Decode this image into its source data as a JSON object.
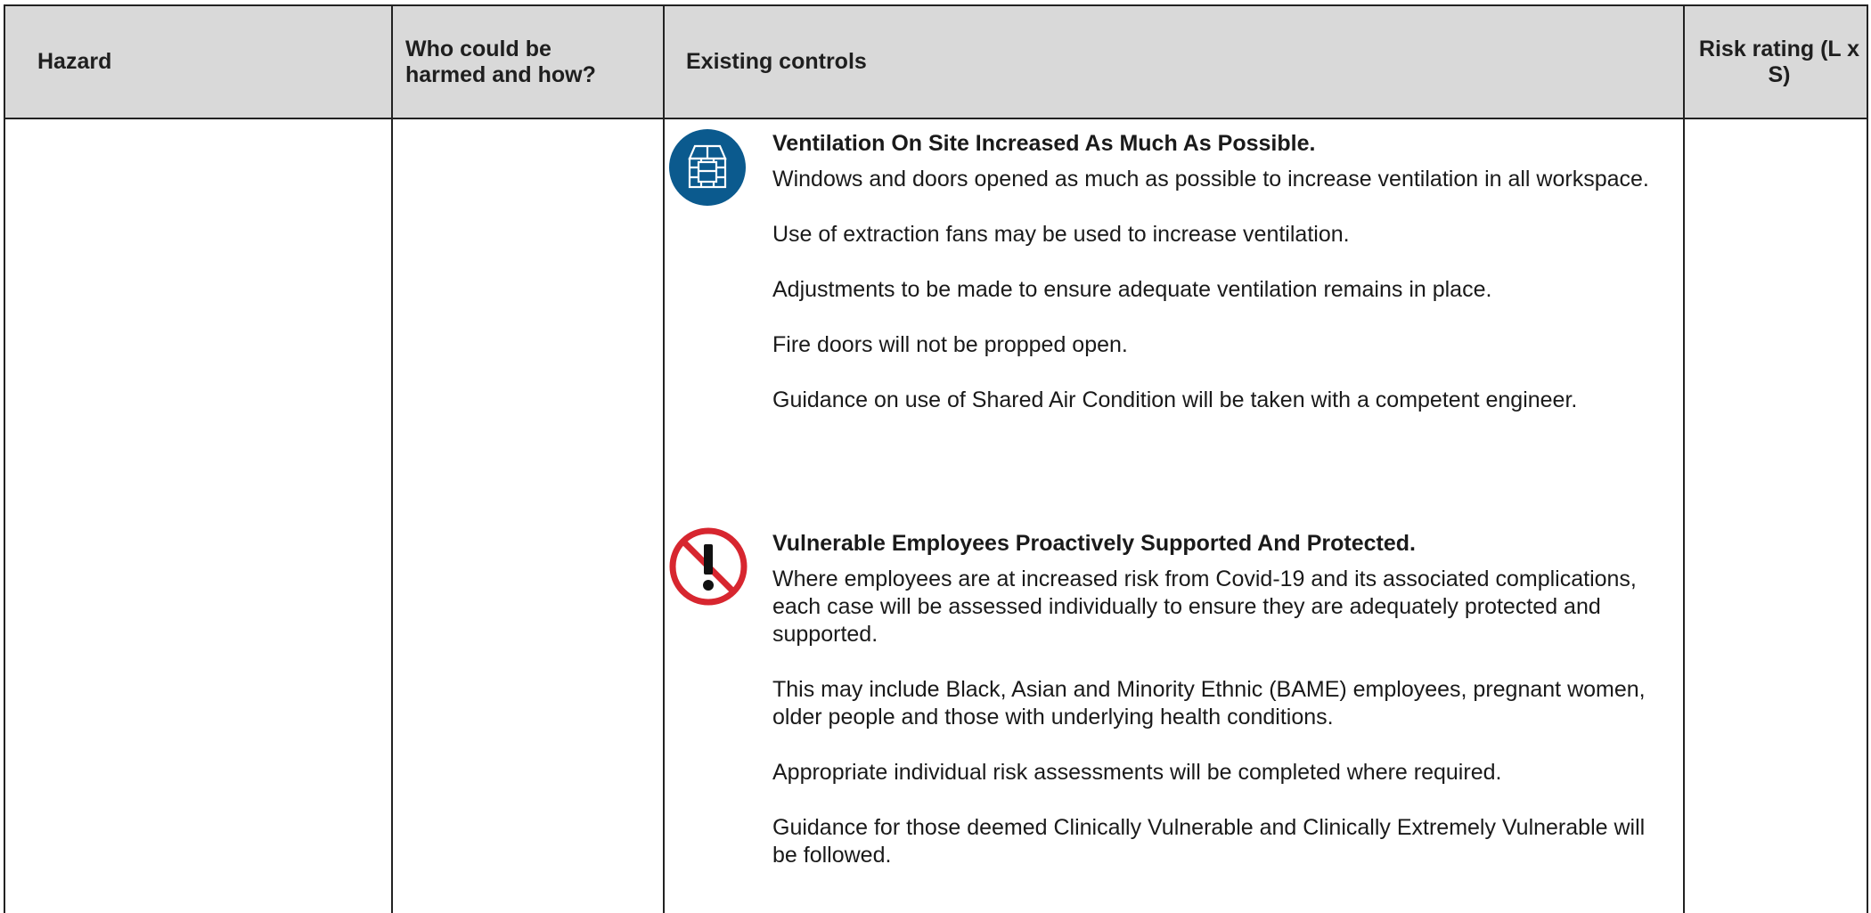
{
  "header": {
    "hazard": "Hazard",
    "who": "Who could be harmed and how?",
    "controls": "Existing controls",
    "risk": "Risk rating (L x S)"
  },
  "sections": [
    {
      "icon": "ventilation-icon",
      "icon_color": "#0b5a8e",
      "title": "Ventilation On Site Increased As Much As Possible.",
      "paragraphs": [
        "Windows and doors opened as much as possible to increase ventilation in all workspace.",
        "Use of extraction fans may be used to increase ventilation.",
        "Adjustments to be made to ensure adequate ventilation remains in place.",
        "Fire doors will not be propped open.",
        "Guidance on use of Shared Air Condition will be taken with a competent engineer."
      ]
    },
    {
      "icon": "prohibition-warning-icon",
      "icon_color": "#d7262f",
      "title": "Vulnerable Employees Proactively Supported And Protected.",
      "paragraphs": [
        "Where employees are at increased risk from Covid-19 and its associated complications, each case will be assessed individually to ensure they are adequately protected and supported.",
        "This may include Black, Asian and Minority Ethnic (BAME) employees, pregnant women, older people and those with underlying health conditions.",
        "Appropriate individual risk assessments will be completed where required.",
        "Guidance for those deemed Clinically Vulnerable and Clinically Extremely Vulnerable will be followed."
      ]
    }
  ]
}
